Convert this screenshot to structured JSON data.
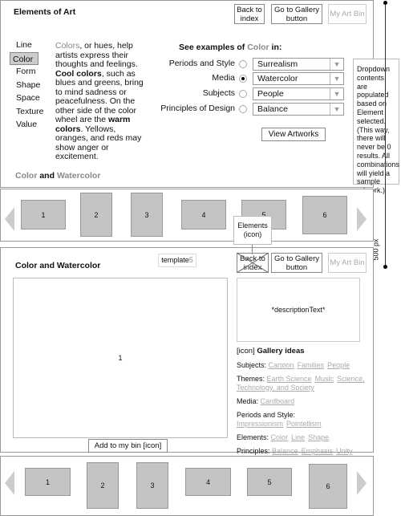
{
  "top": {
    "title": "Elements of Art",
    "back_button": "Back to index",
    "gallery_button": "Go to Gallery button",
    "bin_button": "My Art Bin",
    "nav": [
      "Line",
      "Color",
      "Form",
      "Shape",
      "Space",
      "Texture",
      "Value"
    ],
    "selected": "Color",
    "desc": {
      "w1": "Colors",
      "t1": ", or hues, help artists express their thoughts and feelings. ",
      "b1": "Cool colors",
      "t2": ", such as blues and greens, bring to mind sadness or peacefulness. On the other side of the color wheel are the ",
      "b2": "warm colors",
      "t3": ". Yellows, oranges, and reds may show anger or excitement."
    },
    "see_pre": "See examples of ",
    "see_el": "Color",
    "see_post": " in:",
    "rows": [
      {
        "label": "Periods and Style",
        "value": "Surrealism",
        "checked": false
      },
      {
        "label": "Media",
        "value": "Watercolor",
        "checked": true
      },
      {
        "label": "Subjects",
        "value": "People",
        "checked": false
      },
      {
        "label": "Principles of Design",
        "value": "Balance",
        "checked": false
      }
    ],
    "view_button": "View Artworks",
    "footer_a": "Color",
    "footer_and": " and ",
    "footer_b": "Watercolor"
  },
  "note": "Dropdown contents are populated based on Element selected. (This way, there will never be 0 results. All combinations will yield a sample artwork.)",
  "dimension": "500 px",
  "callout": "Elements (icon)",
  "carousel": [
    "1",
    "2",
    "3",
    "4",
    "5",
    "6"
  ],
  "bottom": {
    "title": "Color and Watercolor",
    "template_pre": "template",
    "template_num": "5",
    "back_button": "Back to index",
    "gallery_button": "Go to Gallery button",
    "bin_button": "My Art Bin",
    "image": "1",
    "add_button": "Add to my bin [icon]",
    "description": "*descriptionText*",
    "ideas_icon": "[icon] ",
    "ideas_title": "Gallery ideas",
    "ideas": [
      {
        "label": "Subjects:",
        "links": [
          "Cartoon",
          "Families",
          "People"
        ]
      },
      {
        "label": "Themes:",
        "links": [
          "Earth Science",
          "Music",
          "Science, Technology, and Society"
        ]
      },
      {
        "label": "Media:",
        "links": [
          "Cardboard"
        ]
      },
      {
        "label": "Periods and Style:",
        "links": [
          "Impressionism",
          "Pointellism"
        ]
      },
      {
        "label": "Elements:",
        "links": [
          "Color",
          "Line",
          "Shape"
        ]
      },
      {
        "label": "Principles:",
        "links": [
          "Balance",
          "Emphasis",
          "Unity"
        ]
      }
    ]
  }
}
